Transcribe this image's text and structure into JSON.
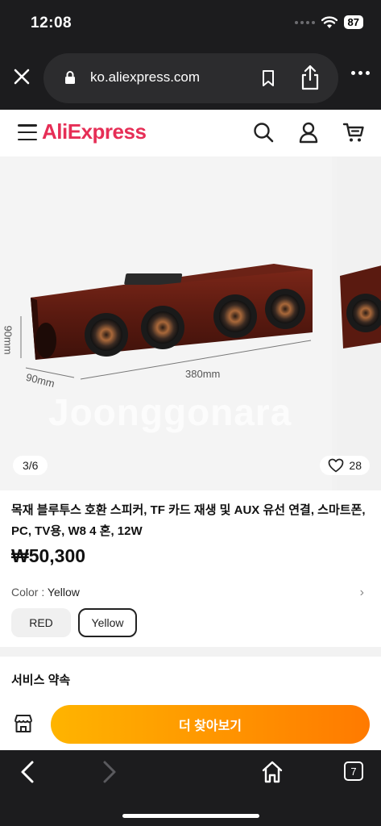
{
  "status_bar": {
    "time": "12:08",
    "battery": "87"
  },
  "browser": {
    "url": "ko.aliexpress.com",
    "tab_count": "7"
  },
  "site": {
    "logo": "AliExpress"
  },
  "gallery": {
    "counter": "3/6",
    "likes": "28",
    "dim_height": "90mm",
    "dim_depth": "90mm",
    "dim_width": "380mm",
    "watermark": "Joonggonara"
  },
  "product": {
    "title": "목재 블루투스 호환 스피커, TF 카드 재생 및 AUX 유선 연결, 스마트폰, PC, TV용, W8 4 혼, 12W",
    "price": "₩50,300",
    "color_label": "Color",
    "color_value": "Yellow",
    "options": [
      "RED",
      "Yellow"
    ],
    "selected_option": "Yellow"
  },
  "service_title": "서비스 약속",
  "cta_label": "더 찾아보기",
  "colors": {
    "brand": "#e62e56",
    "cta_start": "#ffb400",
    "cta_end": "#ff7a00",
    "chrome_bg": "#1c1c1e"
  }
}
